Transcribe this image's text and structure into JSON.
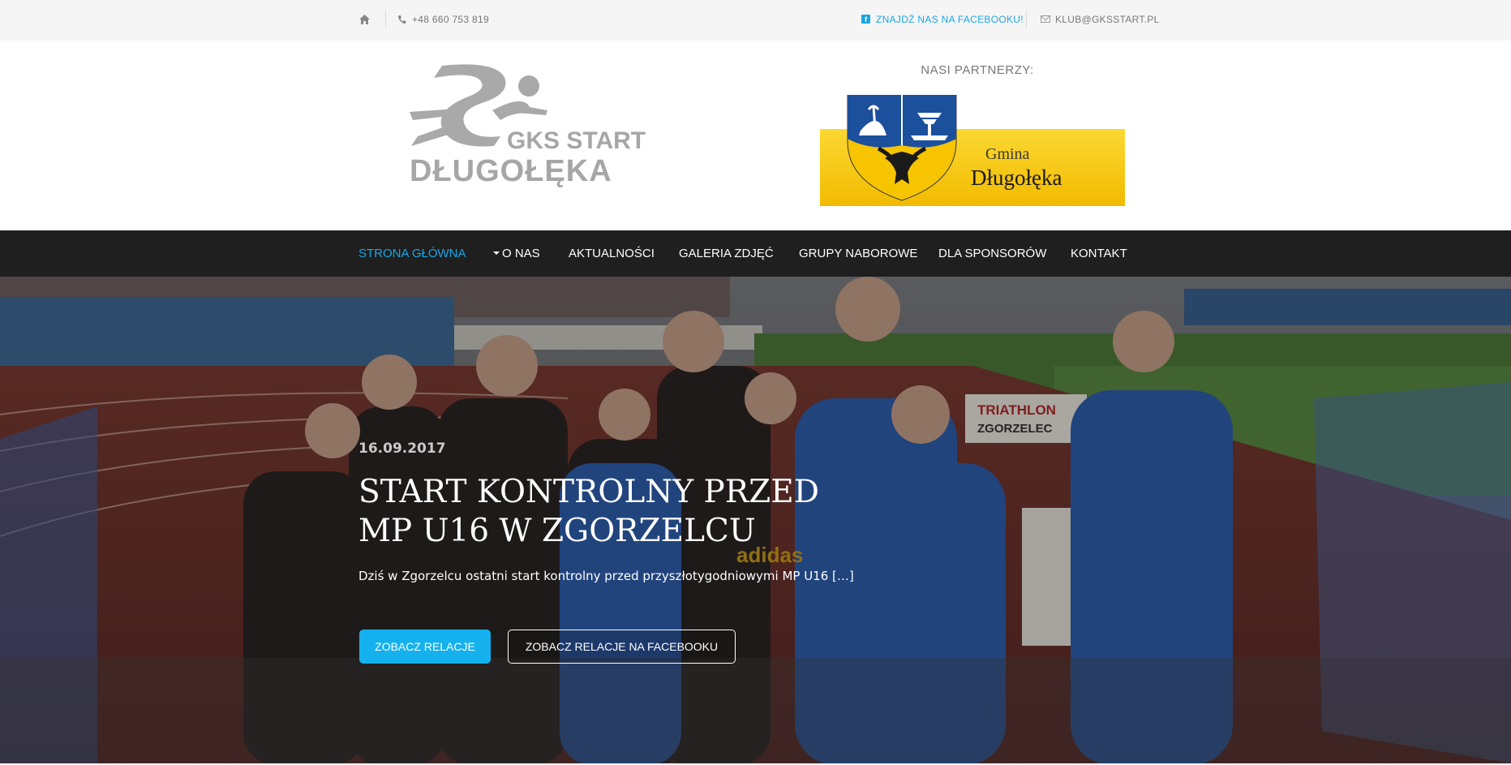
{
  "topbar": {
    "phone": "+48 660 753 819",
    "facebook_link": "ZNAJDŹ NAS NA FACEBOOKU!",
    "email": "KLUB@GKSSTART.PL",
    "icons": [
      "home-icon",
      "phone-icon",
      "facebook-icon",
      "envelope-icon"
    ]
  },
  "header": {
    "logo": {
      "line1": "GKS START",
      "line2": "DŁUGOŁĘKA"
    },
    "partners_label": "NASI PARTNERZY:",
    "partner": {
      "line1": "Gmina",
      "line2": "Długołęka"
    }
  },
  "nav": {
    "items": [
      {
        "label": "STRONA GŁÓWNA"
      },
      {
        "label": "O NAS"
      },
      {
        "label": "AKTUALNOŚCI"
      },
      {
        "label": "GALERIA ZDJĘĆ"
      },
      {
        "label": "GRUPY NABOROWE"
      },
      {
        "label": "DLA SPONSORÓW"
      },
      {
        "label": "KONTAKT"
      }
    ]
  },
  "hero": {
    "date": "16.09.2017",
    "title": "START KONTROLNY PRZED MP U16 W ZGORZELCU",
    "excerpt": "Dziś w Zgorzelcu ostatni start kontrolny przed przyszłotygodniowymi MP U16 […]",
    "primary_button": "ZOBACZ RELACJE",
    "secondary_button": "ZOBACZ RELACJE NA FACEBOOKU",
    "photo_text": {
      "adidas": "adidas",
      "triathlon": "TRIATHLON",
      "zgorzelec": "ZGORZELEC"
    }
  },
  "colors": {
    "accent": "#1aa6e6",
    "button": "#14b1ee",
    "nav_bg": "#1f1f1f",
    "topbar_bg": "#f5f5f5",
    "partner_yellow": "#f5c800"
  }
}
